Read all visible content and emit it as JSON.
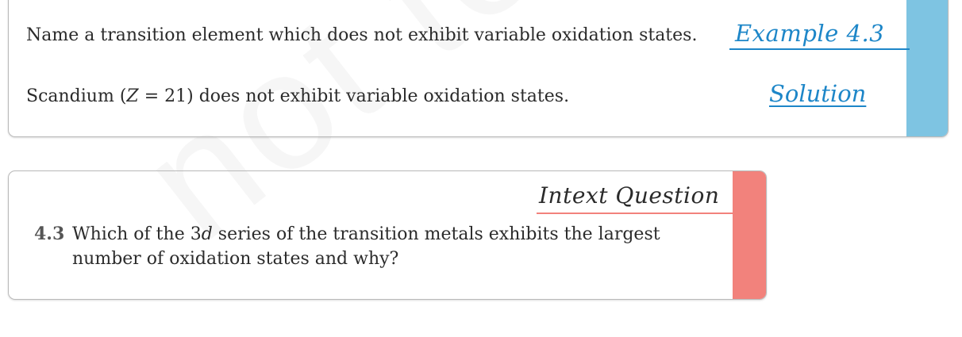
{
  "watermark": "not to",
  "example": {
    "label": "Example 4.3",
    "solution_label": "Solution",
    "question": "Name a transition element which does not exhibit variable oxidation states.",
    "answer_prefix": "Scandium (",
    "answer_z": "Z",
    "answer_suffix": " = 21) does not exhibit variable oxidation states.",
    "accent_color": "#7ec4e2",
    "label_color": "#1d86c8"
  },
  "intext": {
    "title": "Intext Question",
    "number": "4.3",
    "text_part1": "Which of the 3",
    "text_italic": "d",
    "text_part2": " series of the transition metals exhibits the largest number of oxidation states and why?",
    "accent_color": "#f2827c"
  }
}
